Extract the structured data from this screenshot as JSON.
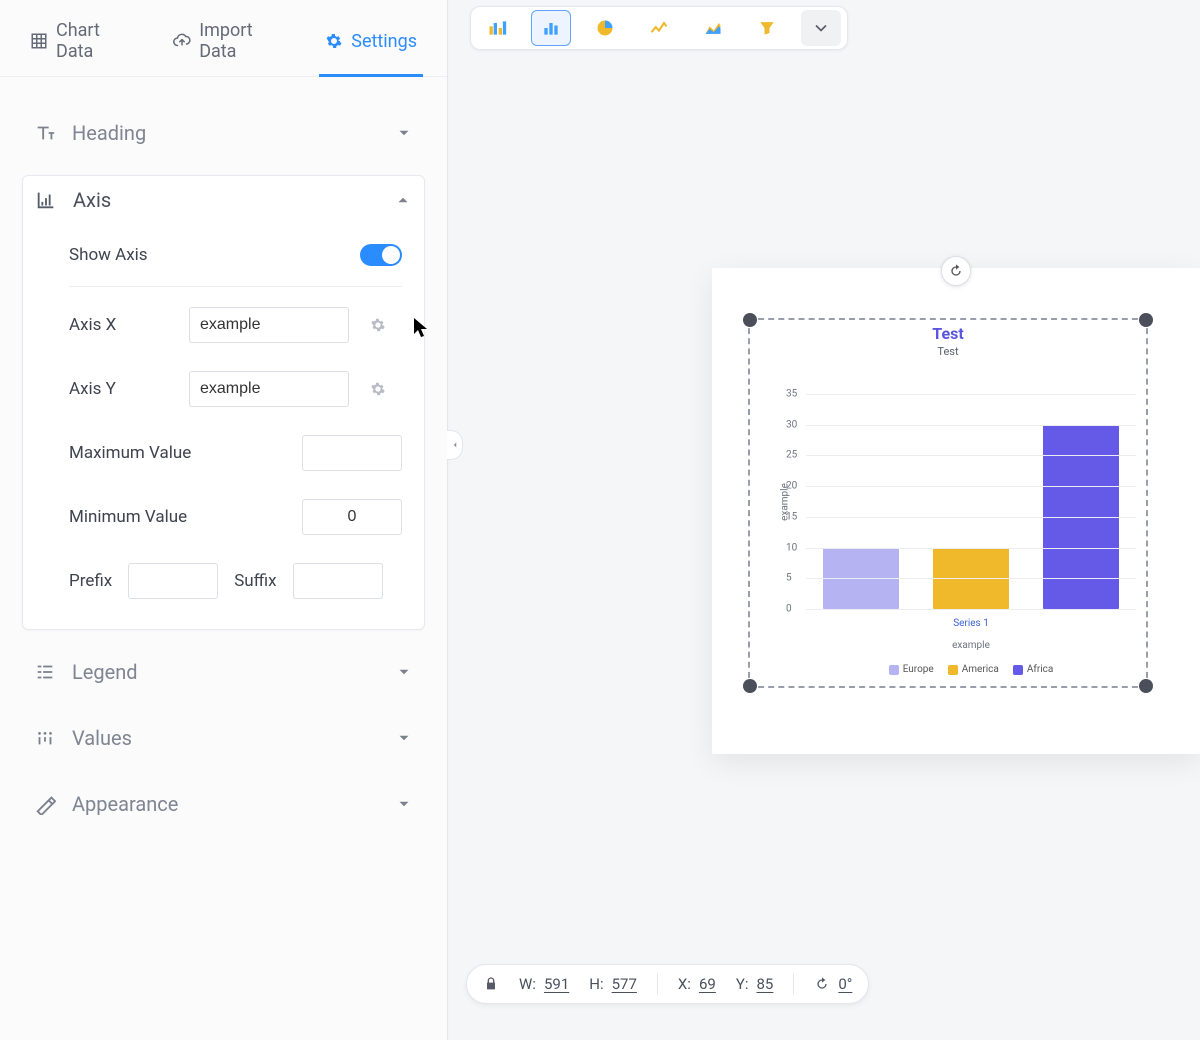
{
  "tabs": {
    "chart_data": "Chart Data",
    "import_data": "Import Data",
    "settings": "Settings"
  },
  "sections": {
    "heading": "Heading",
    "axis": "Axis",
    "legend": "Legend",
    "values": "Values",
    "appearance": "Appearance"
  },
  "axis_panel": {
    "show_axis_label": "Show Axis",
    "axis_x_label": "Axis X",
    "axis_x_value": "example",
    "axis_y_label": "Axis Y",
    "axis_y_value": "example",
    "max_label": "Maximum Value",
    "max_value": "",
    "min_label": "Minimum Value",
    "min_value": "0",
    "prefix_label": "Prefix",
    "prefix_value": "",
    "suffix_label": "Suffix",
    "suffix_value": ""
  },
  "status": {
    "w_label": "W:",
    "w_value": "591",
    "h_label": "H:",
    "h_value": "577",
    "x_label": "X:",
    "x_value": "69",
    "y_label": "Y:",
    "y_value": "85",
    "rot_value": "0°"
  },
  "toolbar_icons": {
    "grouped_bar": "grouped-bar-chart-icon",
    "bar": "bar-chart-icon",
    "pie": "pie-chart-icon",
    "line": "line-chart-icon",
    "area": "area-chart-icon",
    "funnel": "funnel-chart-icon",
    "more": "more-chart-types-icon"
  },
  "chart_data": {
    "type": "bar",
    "title": "Test",
    "subtitle": "Test",
    "xlabel": "example",
    "ylabel": "example",
    "ylim": [
      0,
      35
    ],
    "y_ticks": [
      0,
      5,
      10,
      15,
      20,
      25,
      30,
      35
    ],
    "x_series_label": "Series 1",
    "series": [
      {
        "name": "Europe",
        "values": [
          10
        ],
        "color": "#b6b3f3"
      },
      {
        "name": "America",
        "values": [
          10
        ],
        "color": "#f0b92c"
      },
      {
        "name": "Africa",
        "values": [
          30
        ],
        "color": "#655ae8"
      }
    ]
  },
  "colors": {
    "accent": "#2b8cff"
  }
}
